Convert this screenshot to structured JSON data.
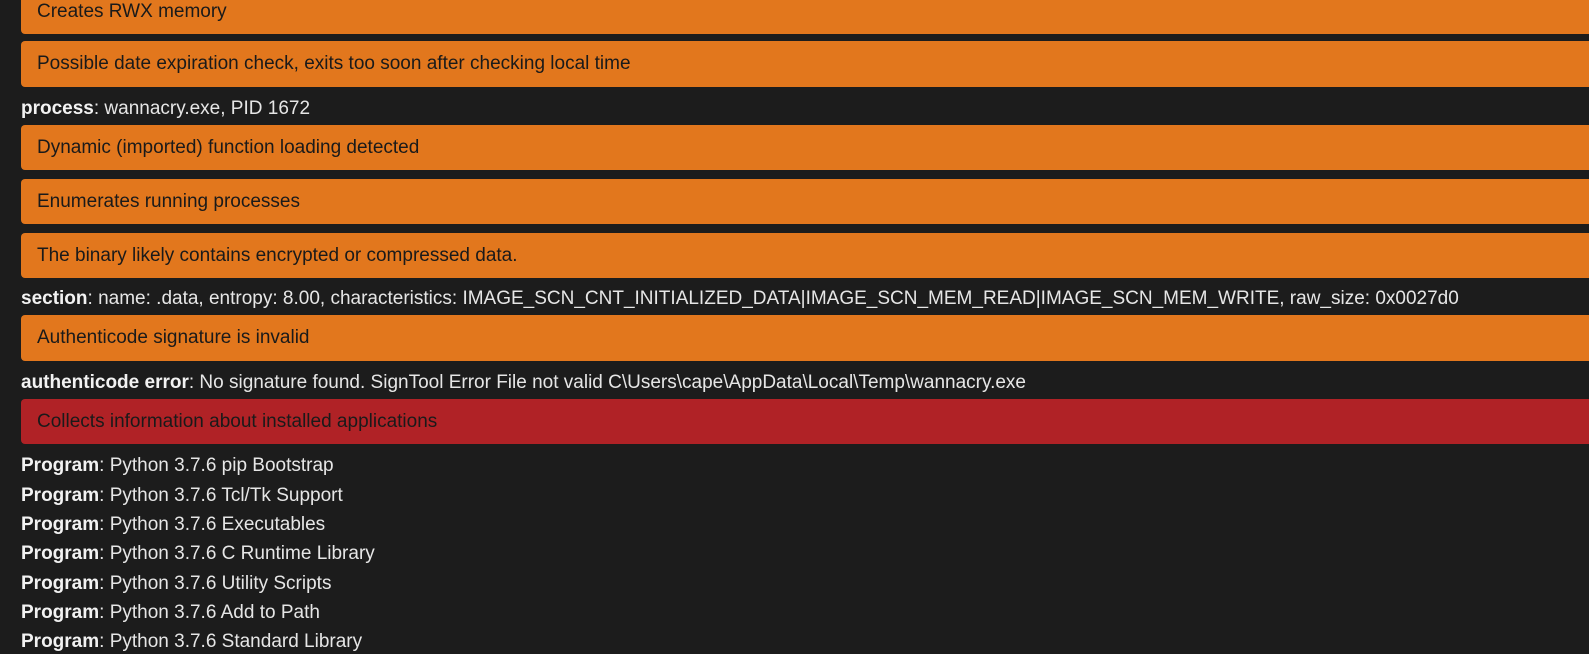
{
  "signatures": {
    "rwx": {
      "label": "Creates RWX memory",
      "severity_color": "#e2771d"
    },
    "date_check": {
      "label": "Possible date expiration check, exits too soon after checking local time",
      "severity_color": "#e2771d"
    },
    "dynamic_loading": {
      "label": "Dynamic (imported) function loading detected",
      "severity_color": "#e2771d"
    },
    "enum_processes": {
      "label": "Enumerates running processes",
      "severity_color": "#e2771d"
    },
    "packed": {
      "label": "The binary likely contains encrypted or compressed data.",
      "severity_color": "#e2771d"
    },
    "authenticode": {
      "label": "Authenticode signature is invalid",
      "severity_color": "#e2771d"
    },
    "installed_apps": {
      "label": "Collects information about installed applications",
      "severity_color": "#b02226"
    }
  },
  "details": {
    "process": {
      "key": "process",
      "value": ": wannacry.exe, PID 1672"
    },
    "section": {
      "key": "section",
      "value": ": name: .data, entropy: 8.00, characteristics: IMAGE_SCN_CNT_INITIALIZED_DATA|IMAGE_SCN_MEM_READ|IMAGE_SCN_MEM_WRITE, raw_size: 0x0027d0"
    },
    "authenticode_error": {
      "key": "authenticode error",
      "value": ": No signature found. SignTool Error File not valid C\\Users\\cape\\AppData\\Local\\Temp\\wannacry.exe"
    }
  },
  "programs": [
    {
      "key": "Program",
      "value": ": Python 3.7.6 pip Bootstrap"
    },
    {
      "key": "Program",
      "value": ": Python 3.7.6 Tcl/Tk Support"
    },
    {
      "key": "Program",
      "value": ": Python 3.7.6 Executables"
    },
    {
      "key": "Program",
      "value": ": Python 3.7.6 C Runtime Library"
    },
    {
      "key": "Program",
      "value": ": Python 3.7.6 Utility Scripts"
    },
    {
      "key": "Program",
      "value": ": Python 3.7.6 Add to Path"
    },
    {
      "key": "Program",
      "value": ": Python 3.7.6 Standard Library"
    }
  ],
  "colors": {
    "background": "#1c1c1c",
    "warning": "#e2771d",
    "danger": "#b02226"
  }
}
